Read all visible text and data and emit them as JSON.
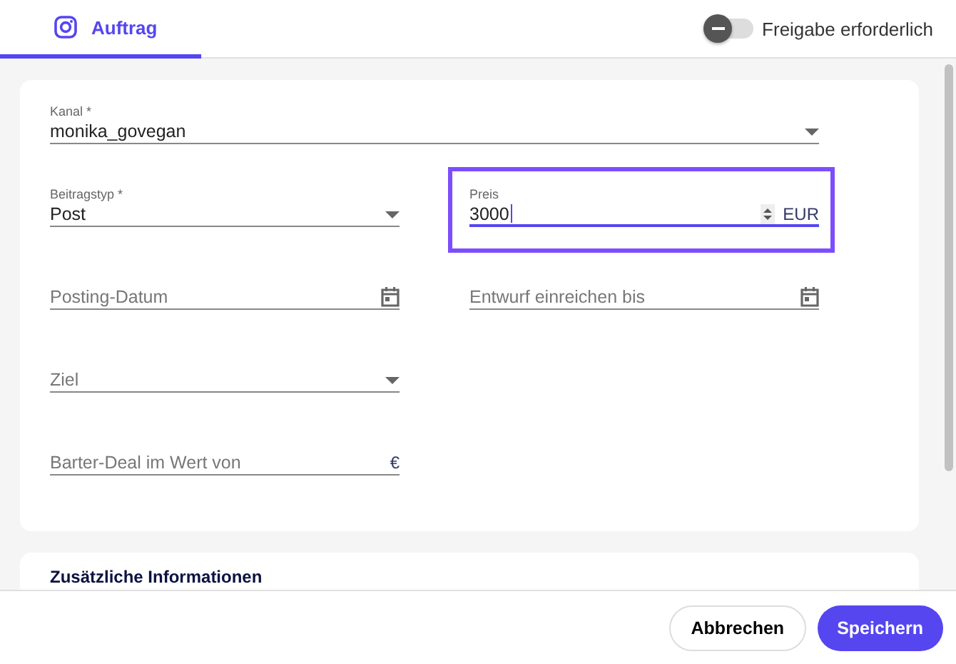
{
  "header": {
    "tab": {
      "label": "Auftrag",
      "selected": true
    },
    "toggle": {
      "label": "Freigabe erforderlich",
      "on": false
    }
  },
  "form": {
    "rows": [
      {
        "fields": [
          {
            "kind": "select",
            "label": "Kanal *",
            "value": "monika_govegan",
            "wide": true
          }
        ]
      },
      {
        "fields": [
          {
            "kind": "select",
            "label": "Beitragstyp *",
            "value": "Post",
            "wide": false
          },
          {
            "kind": "number",
            "label": "Preis",
            "value": "3000",
            "suffix": "EUR",
            "focused": true,
            "wide": false
          }
        ]
      },
      {
        "fields": [
          {
            "kind": "date",
            "placeholder": "Posting-Datum",
            "wide": false
          },
          {
            "kind": "date",
            "placeholder": "Entwurf einreichen bis",
            "wide": false
          }
        ]
      },
      {
        "fields": [
          {
            "kind": "select",
            "placeholder": "Ziel",
            "wide": false
          }
        ]
      },
      {
        "fields": [
          {
            "kind": "currency",
            "placeholder": "Barter-Deal im Wert von",
            "suffix": "€",
            "wide": false
          }
        ]
      }
    ]
  },
  "next_section": {
    "title": "Zusätzliche Informationen"
  },
  "footer": {
    "buttons": [
      {
        "label": "Abbrechen",
        "kind": "secondary"
      },
      {
        "label": "Speichern",
        "kind": "primary"
      }
    ]
  }
}
